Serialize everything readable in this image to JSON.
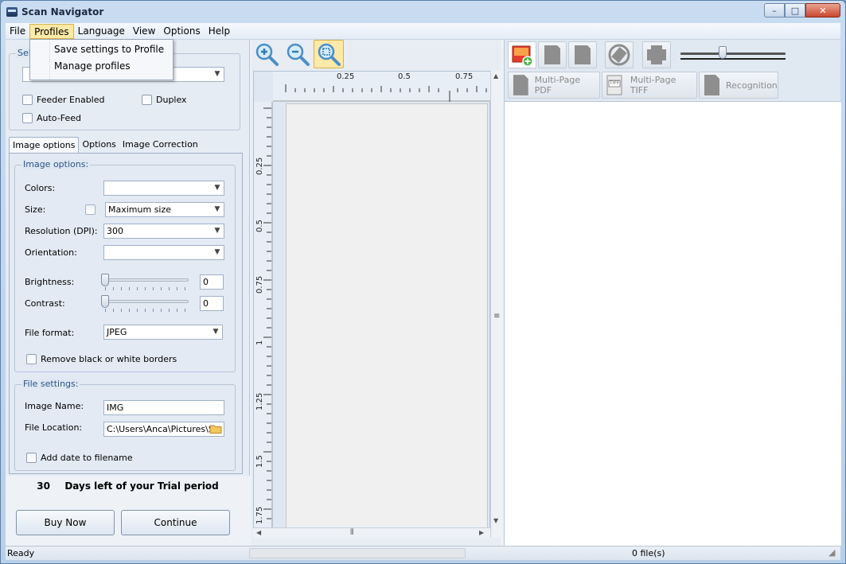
{
  "window": {
    "title": "Scan Navigator",
    "controls": {
      "minimize": "–",
      "maximize": "□",
      "close": "✕"
    }
  },
  "menu": {
    "items": [
      {
        "label": "File"
      },
      {
        "label": "Profiles"
      },
      {
        "label": "Language"
      },
      {
        "label": "View"
      },
      {
        "label": "Options"
      },
      {
        "label": "Help"
      }
    ],
    "profiles_dropdown": {
      "items": [
        {
          "label": "Save settings to Profile"
        },
        {
          "label": "Manage profiles"
        }
      ]
    }
  },
  "source": {
    "legend": "Sel",
    "scanner_value": "",
    "feeder_enabled": "Feeder Enabled",
    "duplex": "Duplex",
    "auto_feed": "Auto-Feed"
  },
  "tabs": [
    {
      "label": "Image options",
      "active": true
    },
    {
      "label": "Options",
      "active": false
    },
    {
      "label": "Image Correction",
      "active": false
    }
  ],
  "image_options": {
    "legend": "Image options:",
    "colors_label": "Colors:",
    "colors_value": "",
    "size_label": "Size:",
    "size_value": "Maximum size",
    "resolution_label": "Resolution (DPI):",
    "resolution_value": "300",
    "orientation_label": "Orientation:",
    "orientation_value": "",
    "brightness_label": "Brightness:",
    "brightness_value": "0",
    "contrast_label": "Contrast:",
    "contrast_value": "0",
    "file_format_label": "File format:",
    "file_format_value": "JPEG",
    "remove_borders_label": "Remove black or white borders"
  },
  "file_settings": {
    "legend": "File settings:",
    "image_name_label": "Image Name:",
    "image_name_value": "IMG",
    "file_location_label": "File Location:",
    "file_location_value": "C:\\Users\\Anca\\Pictures\\Sc",
    "add_date_label": "Add date to filename"
  },
  "trial": {
    "days": "30",
    "text": "Days left of your Trial period",
    "buy_now": "Buy Now",
    "continue": "Continue"
  },
  "ruler": {
    "h_labels": [
      "0.25",
      "0.5",
      "0.75"
    ],
    "v_labels": [
      "0.25",
      "0.5",
      "0.75",
      "1",
      "1.25",
      "1.5",
      "1.75"
    ]
  },
  "right_toolbar": {
    "multi_page_pdf": "Multi-Page PDF",
    "multi_page_tiff": "Multi-Page TIFF",
    "tiff_badge": "TIFF",
    "recognition": "Recognition"
  },
  "status": {
    "ready": "Ready",
    "files": "0 file(s)"
  },
  "colors": {
    "accent_highlight": "#fde9a8",
    "legend_blue": "#2a5389",
    "close_red": "#c9472e"
  }
}
